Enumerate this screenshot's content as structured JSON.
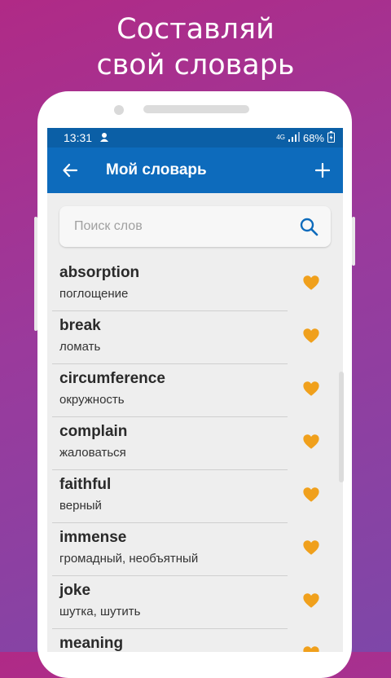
{
  "promo": {
    "line1": "Составляй",
    "line2": "свой словарь"
  },
  "status": {
    "time": "13:31",
    "network": "4G",
    "battery": "68%"
  },
  "appbar": {
    "title": "Мой словарь"
  },
  "search": {
    "placeholder": "Поиск слов"
  },
  "colors": {
    "accent": "#0d6bbc",
    "status_bar": "#0b5fa6",
    "heart": "#f0a01c"
  },
  "words": [
    {
      "word": "absorption",
      "translation": "поглощение"
    },
    {
      "word": "break",
      "translation": "ломать"
    },
    {
      "word": "circumference",
      "translation": "окружность"
    },
    {
      "word": "complain",
      "translation": "жаловаться"
    },
    {
      "word": "faithful",
      "translation": "верный"
    },
    {
      "word": "immense",
      "translation": "громадный, необъятный"
    },
    {
      "word": "joke",
      "translation": "шутка, шутить"
    },
    {
      "word": "meaning",
      "translation": ""
    }
  ]
}
